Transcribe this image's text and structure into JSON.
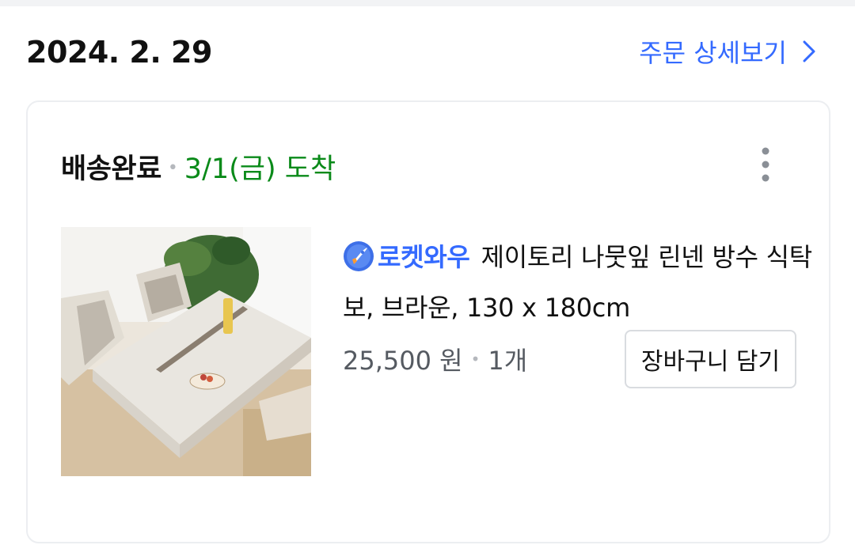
{
  "order": {
    "date": "2024. 2. 29",
    "detail_link_label": "주문 상세보기"
  },
  "shipment": {
    "status": "배송완료",
    "arrival": "3/1(금) 도착"
  },
  "product": {
    "badge": "로켓와우",
    "name": "제이토리 나뭇잎 린넨 방수 식탁보, 브라운, 130 x 180cm",
    "price": "25,500 원",
    "quantity": "1개",
    "add_to_cart_label": "장바구니 담기"
  },
  "colors": {
    "accent": "#346aff",
    "arrival_green": "#0a8a19"
  }
}
